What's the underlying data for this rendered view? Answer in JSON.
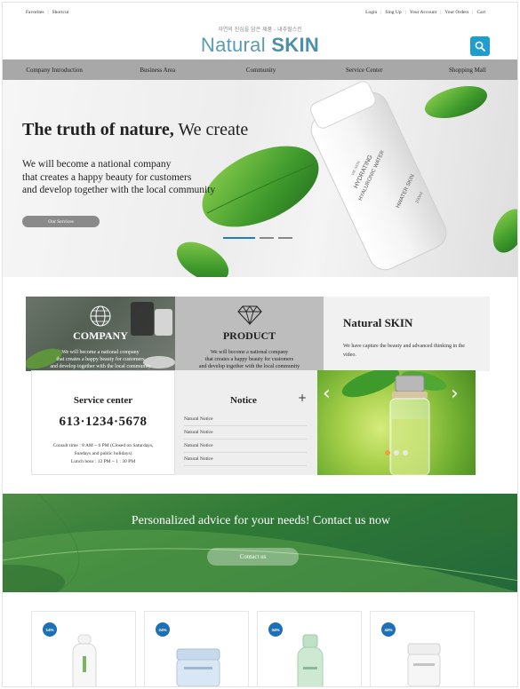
{
  "topbar": {
    "left_links": [
      "Favorites",
      "Shortcut"
    ],
    "right_links": [
      "Login",
      "Sing Up",
      "Your Account",
      "Your Orders",
      "Cart"
    ]
  },
  "brand": {
    "tagline": "자연의 진심을 담은 제품 - 내추럴스킨",
    "logo_regular": "Natural ",
    "logo_bold": "SKIN"
  },
  "search": {
    "icon": "search-icon"
  },
  "nav": {
    "items": [
      "Company Introduction",
      "Business Area",
      "Community",
      "Service Center",
      "Shopping Mall"
    ]
  },
  "hero": {
    "title_bold": "The truth of nature,",
    "title_rest": " We create",
    "subtitle_lines": [
      "We will become a national company",
      "that creates a happy beauty for customers",
      "and develop together with the local community"
    ],
    "button": "Our Services",
    "bottle_text": [
      "WE SKIN",
      "HYDRATING",
      "HYALURONIC WATER",
      "HWATER SKIN",
      "200ml"
    ],
    "slides": 3,
    "active_slide": 1
  },
  "features": {
    "company": {
      "title": "COMPANY",
      "icon": "globe-icon",
      "text": [
        "We will become a national company",
        "that creates a happy beauty for customers",
        "and develop together with the local community"
      ]
    },
    "product": {
      "title": "PRODUCT",
      "icon": "diamond-icon",
      "text": [
        "We will become a national company",
        "that creates a happy beauty for customers",
        "and develop together with the local community"
      ]
    },
    "skin": {
      "title": "Natural SKIN",
      "text": "We have capture the beauty and advanced thinking in the video."
    }
  },
  "service": {
    "title": "Service center",
    "phone": "613·1234·5678",
    "hours": [
      "Consult time : 8 AM ~ 6 PM (Closed on Saturdays,",
      "Sundays and public holidays)",
      "Lunch hour : 12 PM ~ 1 : 30 PM"
    ]
  },
  "notice": {
    "title": "Notice",
    "more": "+",
    "items": [
      "Natural Notice",
      "Natural Notice",
      "Natural Notice",
      "Natural Notice"
    ]
  },
  "promo": {
    "prev": "‹",
    "next": "›",
    "dots": 3,
    "active_dot": 1
  },
  "contact": {
    "title": "Personalized advice for your needs! Contact us now",
    "button": "Contact us"
  },
  "products": [
    {
      "badge": "14%"
    },
    {
      "badge": "24%"
    },
    {
      "badge": "34%"
    },
    {
      "badge": "44%"
    }
  ],
  "colors": {
    "accent": "#1f9cd0",
    "nav_bg": "#a8a8a8",
    "badge": "#1d6fb8",
    "contact_bg": "#2f7a36"
  }
}
